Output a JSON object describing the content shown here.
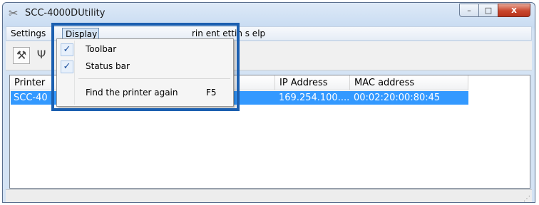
{
  "window": {
    "title": "SCC-4000DUtility",
    "min_glyph": "–",
    "max_glyph": "□",
    "close_glyph": "x"
  },
  "menubar": {
    "items": [
      {
        "label": "Settings"
      },
      {
        "label": "Display"
      }
    ],
    "obscured_text": "rin   ent  ettin s  elp"
  },
  "toolbar": {
    "buttons": [
      {
        "icon": "settings-tool-icon"
      },
      {
        "icon": "antenna-icon"
      }
    ]
  },
  "list": {
    "columns": [
      "Printer",
      "IP Address",
      "MAC address"
    ],
    "rows": [
      {
        "printer": "SCC-40",
        "ip": "169.254.100....",
        "mac": "00:02:20:00:80:45",
        "selected": true
      }
    ]
  },
  "display_menu": {
    "items": [
      {
        "label": "Toolbar",
        "checked": true,
        "shortcut": ""
      },
      {
        "label": "Status bar",
        "checked": true,
        "shortcut": ""
      },
      {
        "label": "Find the printer again",
        "checked": false,
        "shortcut": "F5"
      }
    ]
  },
  "colors": {
    "selection": "#3399ff",
    "highlight_box": "#1b5fb0"
  }
}
